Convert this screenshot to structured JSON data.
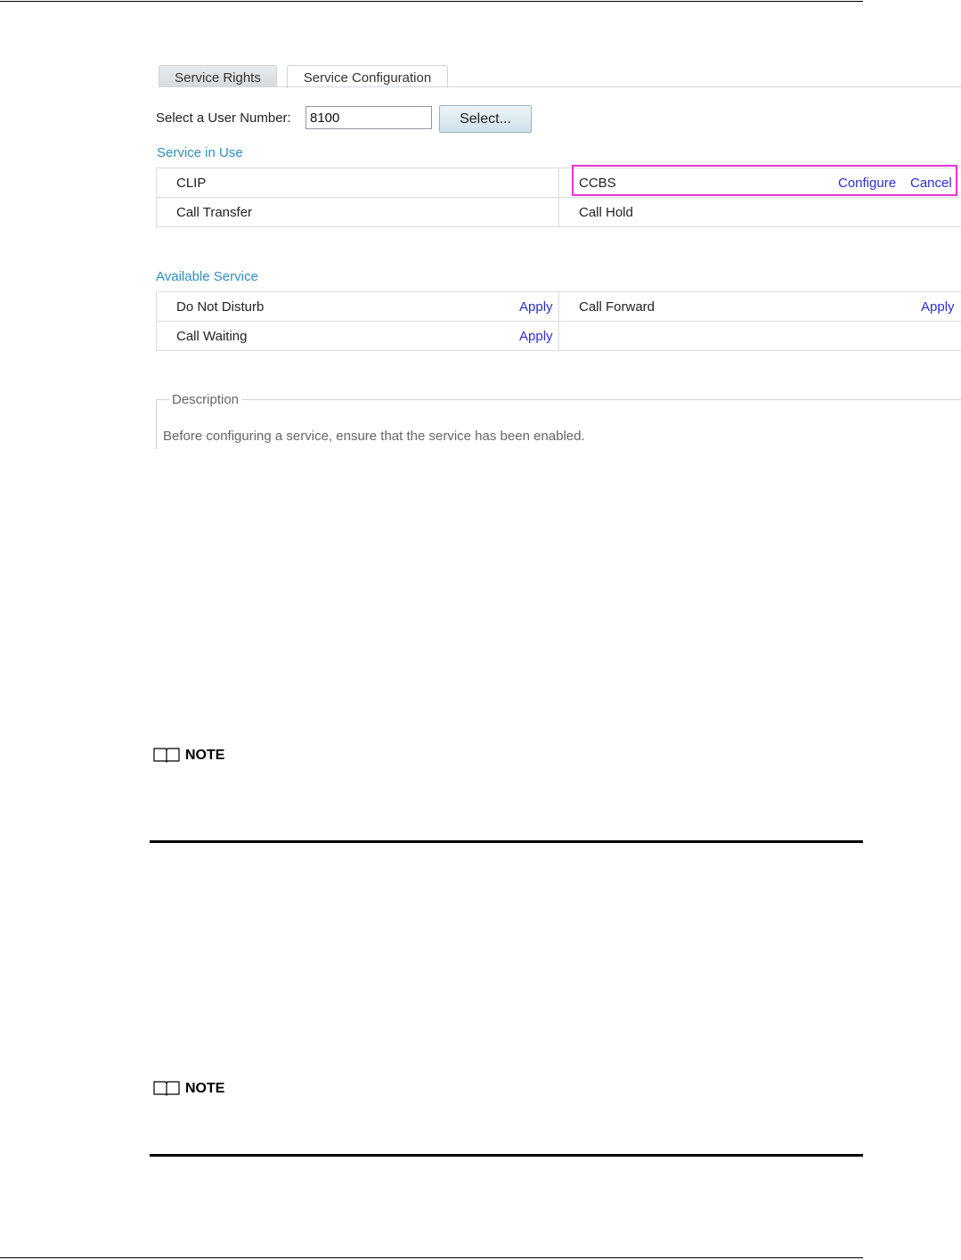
{
  "tabs": [
    {
      "label": "Service Rights",
      "active": false
    },
    {
      "label": "Service Configuration",
      "active": true
    }
  ],
  "user_select": {
    "label": "Select a User Number:",
    "value": "8100",
    "button": "Select..."
  },
  "service_in_use": {
    "title": "Service in Use",
    "rows": [
      {
        "left": "CLIP",
        "right": "CCBS",
        "right_links": [
          "Configure",
          "Cancel"
        ]
      },
      {
        "left": "Call Transfer",
        "right": "Call Hold"
      }
    ]
  },
  "available_service": {
    "title": "Available Service",
    "rows": [
      {
        "left": "Do Not Disturb",
        "left_link": "Apply",
        "right": "Call Forward",
        "right_link": "Apply"
      },
      {
        "left": "Call Waiting",
        "left_link": "Apply",
        "right": ""
      }
    ]
  },
  "description": {
    "legend": "Description",
    "text": "Before configuring a service, ensure that the service has been enabled."
  },
  "notes": [
    {
      "label": "NOTE"
    },
    {
      "label": "NOTE"
    }
  ],
  "colors": {
    "section_title": "#2e8fc0",
    "link": "#2d2dd6",
    "highlight": "#e535d7"
  },
  "icons": {
    "note": "book-icon"
  }
}
